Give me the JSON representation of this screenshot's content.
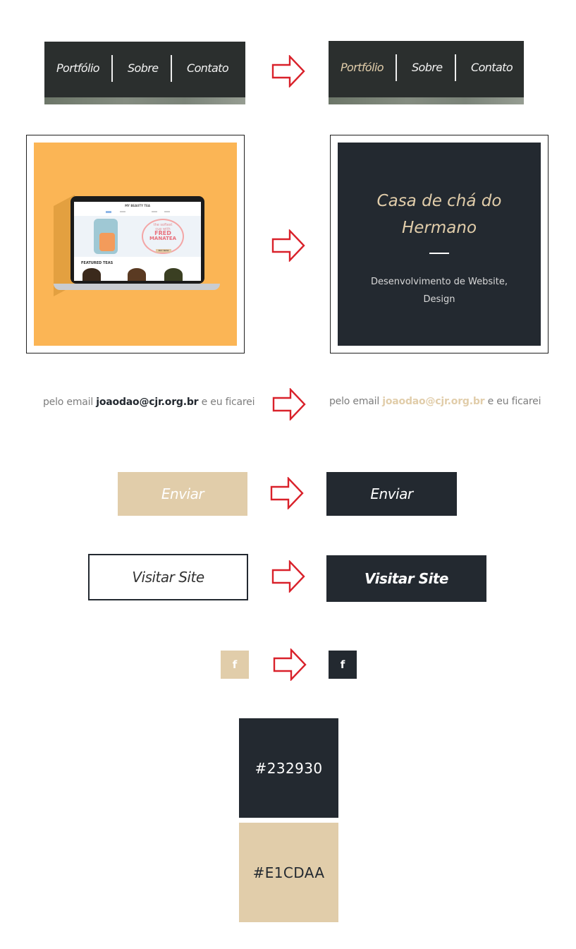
{
  "nav_before": {
    "items": [
      "Portfólio",
      "Sobre",
      "Contato"
    ]
  },
  "nav_after": {
    "items": [
      "Portfólio",
      "Sobre",
      "Contato"
    ]
  },
  "portfolio_card": {
    "title": "Casa de chá do Hermano",
    "subtitle": "Desenvolvimento de Website, Design",
    "mockup": {
      "site_name": "MY BEAUTY TEA",
      "banner_lines": [
        "the softest",
        "cup with",
        "FRED",
        "MANATEA"
      ],
      "banner_button": "BUY NOW",
      "section_title": "FEATURED TEAS"
    }
  },
  "email_before": {
    "prefix": "pelo email",
    "email": "joaodao@cjr.org.br",
    "suffix": "e eu ficarei"
  },
  "email_after": {
    "prefix": "pelo email",
    "email": "joaodao@cjr.org.br",
    "suffix": "e eu ficarei"
  },
  "buttons": {
    "enviar_before": "Enviar",
    "enviar_after": "Enviar",
    "visitar_before": "Visitar Site",
    "visitar_after": "Visitar Site"
  },
  "social": {
    "icon_glyph": "f"
  },
  "palette": [
    {
      "hex": "#232930",
      "label": "#232930"
    },
    {
      "hex": "#E1CDAA",
      "label": "#E1CDAA"
    }
  ],
  "colors": {
    "dark": "#232930",
    "beige": "#E1CDAA",
    "arrow": "#D9212A",
    "orange": "#FBB555",
    "nav_bg": "#2B2F2E"
  }
}
